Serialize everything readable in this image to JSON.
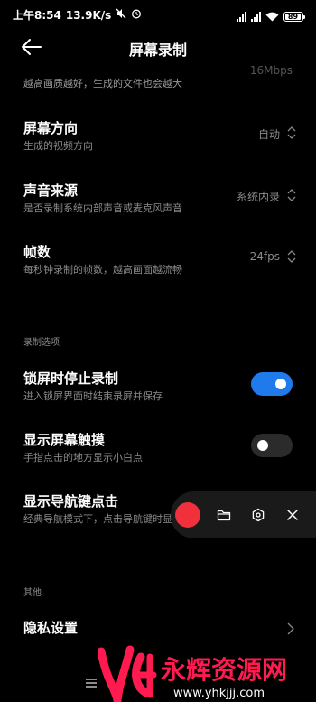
{
  "status_bar": {
    "time": "上午8:54",
    "net_speed": "13.9K/s",
    "battery": "89"
  },
  "header": {
    "title": "屏幕录制"
  },
  "settings": {
    "partial_sub": "越高画质越好，生成的文件也会越大",
    "partial_value": "16Mbps",
    "orientation": {
      "title": "屏幕方向",
      "subtitle": "生成的视频方向",
      "value": "自动"
    },
    "sound_source": {
      "title": "声音来源",
      "subtitle": "是否录制系统内部声音或麦克风声音",
      "value": "系统内录"
    },
    "frame_rate": {
      "title": "帧数",
      "subtitle": "每秒钟录制的帧数，越高画面越流畅",
      "value": "24fps"
    }
  },
  "record_options": {
    "section_label": "录制选项",
    "stop_on_lock": {
      "title": "锁屏时停止录制",
      "subtitle": "进入锁屏界面时结束录屏并保存",
      "enabled": true
    },
    "show_touches": {
      "title": "显示屏幕触摸",
      "subtitle": "手指点击的地方显示小白点",
      "enabled": false
    },
    "show_nav_clicks": {
      "title": "显示导航键点击",
      "subtitle": "经典导航模式下，点击导航键时显示提示",
      "enabled": false
    }
  },
  "other": {
    "section_label": "其他",
    "privacy": {
      "title": "隐私设置"
    }
  },
  "watermark": {
    "brand": "永辉资源网",
    "url": "www.yhkjjj.com"
  },
  "colors": {
    "accent": "#1f7aeb",
    "record": "#f0303a",
    "background": "#000000"
  }
}
